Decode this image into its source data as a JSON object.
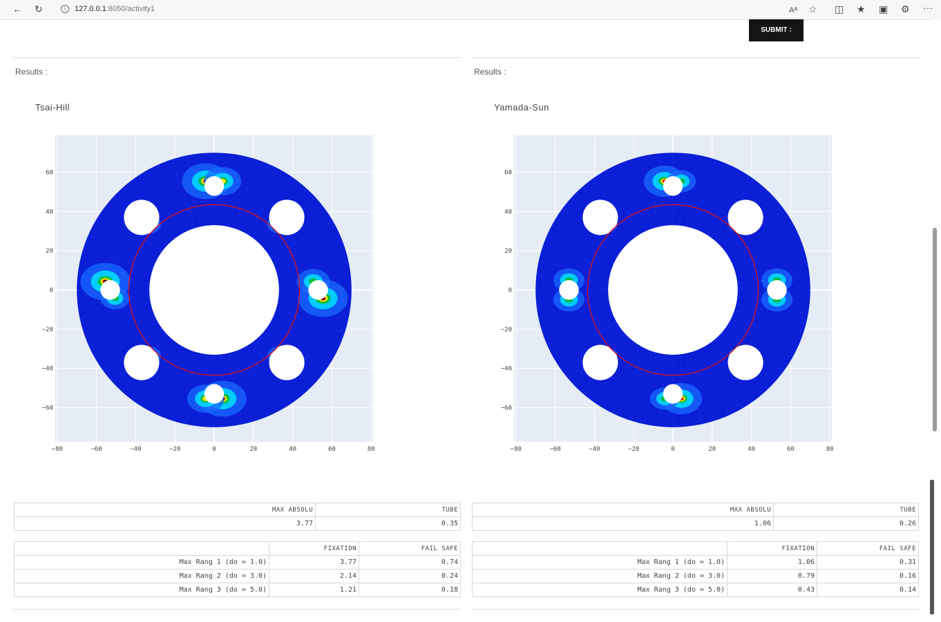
{
  "browser": {
    "url_host": "127.0.0.1",
    "url_rest": ":8050/activity1",
    "reader_label": "Aᴬ",
    "more_label": "···"
  },
  "submit_label": "SUBMIT :",
  "panels": [
    {
      "results_label": "Results :",
      "plot_title": "Tsai-Hill",
      "x_ticks": [
        "−80",
        "−60",
        "−40",
        "−20",
        "0",
        "20",
        "40",
        "60",
        "80"
      ],
      "y_ticks": [
        "60",
        "40",
        "20",
        "0",
        "−20",
        "−40",
        "−60"
      ],
      "table1": {
        "headers": [
          "MAX ABSOLU",
          "TUBE"
        ],
        "values": [
          "3.77",
          "0.35"
        ]
      },
      "table2": {
        "headers": [
          "",
          "FIXATION",
          "FAIL SAFE"
        ],
        "rows": [
          [
            "Max Rang 1 (do = 1.0)",
            "3.77",
            "0.74"
          ],
          [
            "Max Rang 2 (do = 3.0)",
            "2.14",
            "0.24"
          ],
          [
            "Max Rang 3 (do = 5.0)",
            "1.21",
            "0.18"
          ]
        ]
      }
    },
    {
      "results_label": "Results :",
      "plot_title": "Yamada-Sun",
      "x_ticks": [
        "−80",
        "−60",
        "−40",
        "−20",
        "0",
        "20",
        "40",
        "60",
        "80"
      ],
      "y_ticks": [
        "60",
        "40",
        "20",
        "0",
        "−20",
        "−40",
        "−60"
      ],
      "table1": {
        "headers": [
          "MAX ABSOLU",
          "TUBE"
        ],
        "values": [
          "1.06",
          "0.26"
        ]
      },
      "table2": {
        "headers": [
          "",
          "FIXATION",
          "FAIL SAFE"
        ],
        "rows": [
          [
            "Max Rang 1 (do = 1.0)",
            "1.06",
            "0.31"
          ],
          [
            "Max Rang 2 (do = 3.0)",
            "0.79",
            "0.16"
          ],
          [
            "Max Rang 3 (do = 5.0)",
            "0.43",
            "0.14"
          ]
        ]
      }
    }
  ],
  "colors": {
    "plot_bg": "#e5ecf6",
    "ring": "#0a1fd6",
    "circle": "#e0101a",
    "hot1": "#00e0ff",
    "hot2": "#00c040",
    "hot3": "#f5e600",
    "hot4": "#e00000",
    "hot5": "#000000"
  }
}
